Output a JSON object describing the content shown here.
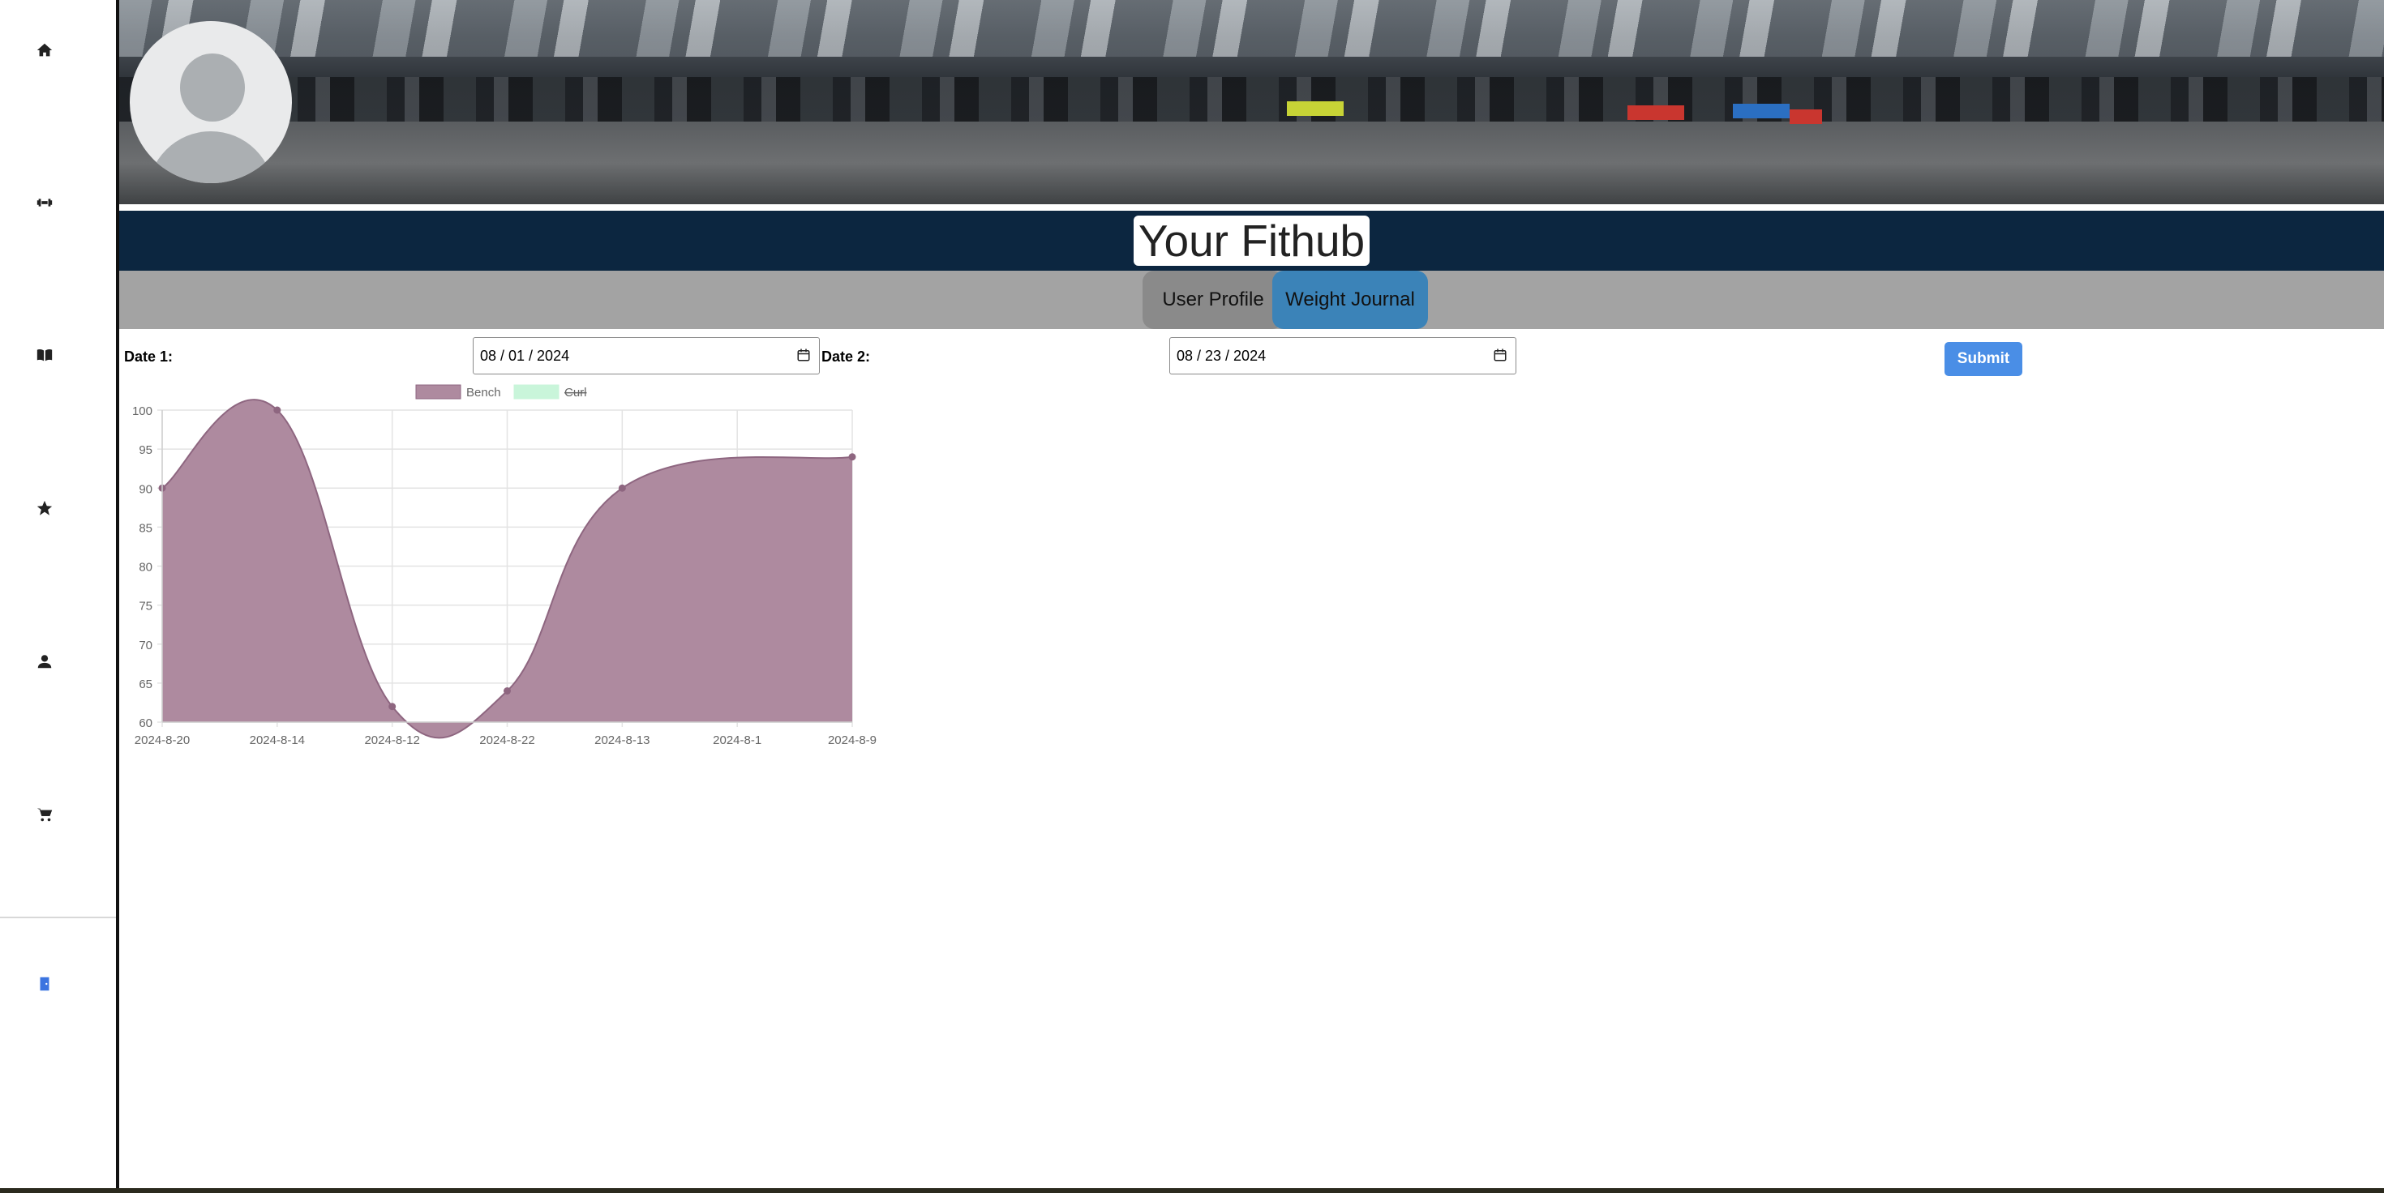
{
  "sidebar": {
    "items": [
      {
        "icon": "home-icon"
      },
      {
        "icon": "dumbbell-icon"
      },
      {
        "icon": "book-icon"
      },
      {
        "icon": "star-icon"
      },
      {
        "icon": "user-icon"
      },
      {
        "icon": "cart-icon"
      }
    ],
    "logout_icon": "door-exit-icon",
    "logout_color": "#3b74e0"
  },
  "header": {
    "title": "Your Fithub",
    "title_bar_color": "#0c2640"
  },
  "tabs": [
    {
      "label": "User Profile",
      "active": false
    },
    {
      "label": "Weight Journal",
      "active": true
    }
  ],
  "form": {
    "date1_label": "Date 1:",
    "date1_value": "08 / 01 / 2024",
    "date2_label": "Date 2:",
    "date2_value": "08 / 23 / 2024",
    "submit_label": "Submit"
  },
  "chart_data": {
    "type": "area",
    "categories": [
      "2024-8-20",
      "2024-8-14",
      "2024-8-12",
      "2024-8-22",
      "2024-8-13",
      "2024-8-1",
      "2024-8-9"
    ],
    "series": [
      {
        "name": "Bench",
        "values": [
          90,
          100,
          62,
          64,
          90,
          null,
          94
        ],
        "color": "#ae8a9f",
        "visible": true
      },
      {
        "name": "Curl",
        "values": [],
        "color": "#c9f5da",
        "visible": false
      }
    ],
    "ylim": [
      60,
      100
    ],
    "yticks": [
      60,
      65,
      70,
      75,
      80,
      85,
      90,
      95,
      100
    ],
    "grid": true,
    "legend": "top-left"
  }
}
